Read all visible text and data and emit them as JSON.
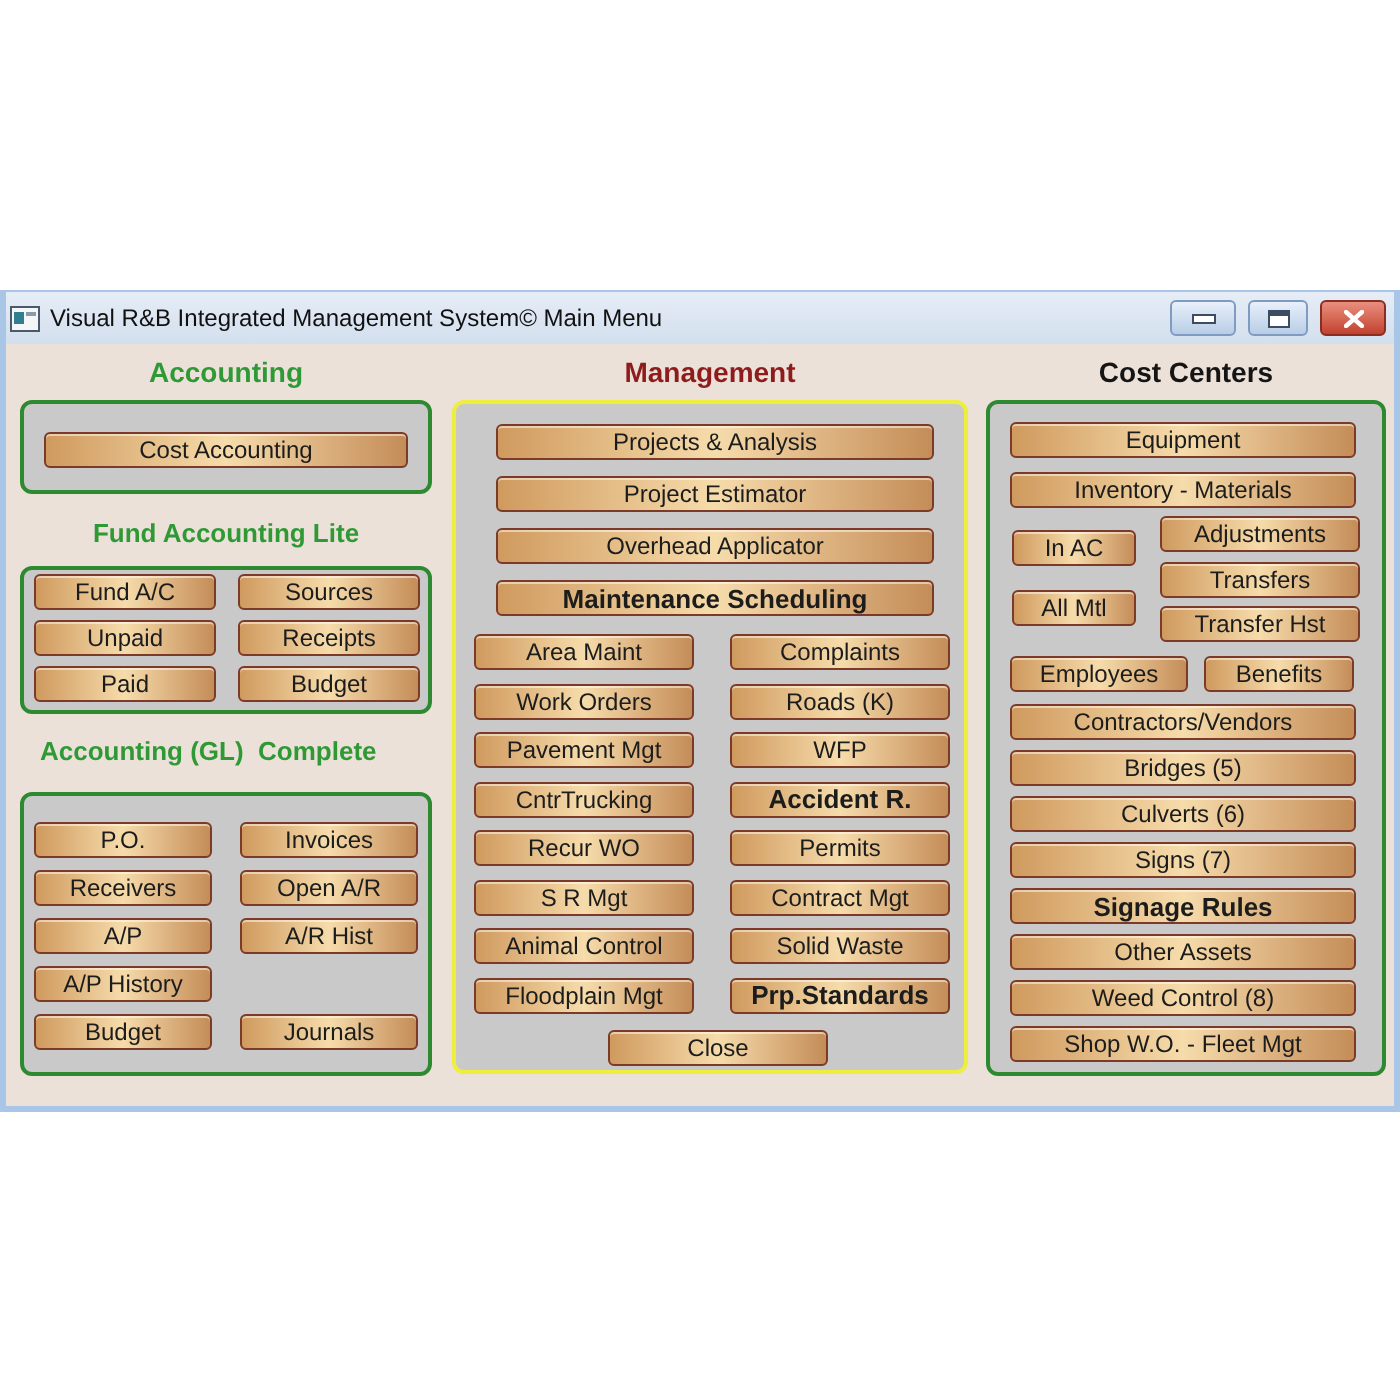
{
  "window": {
    "title": "Visual R&B Integrated Management System© Main Menu"
  },
  "accounting": {
    "heading": "Accounting",
    "button": {
      "label": "Cost Accounting",
      "bold": false
    }
  },
  "fund_accounting_lite": {
    "heading": "Fund Accounting Lite",
    "rows": [
      [
        {
          "label": "Fund A/C",
          "bold": false
        },
        {
          "label": "Sources",
          "bold": false
        }
      ],
      [
        {
          "label": "Unpaid",
          "bold": false
        },
        {
          "label": "Receipts",
          "bold": false
        }
      ],
      [
        {
          "label": "Paid",
          "bold": false
        },
        {
          "label": "Budget",
          "bold": false
        }
      ]
    ]
  },
  "accounting_gl": {
    "heading": "Accounting (GL)  Complete",
    "rows": [
      [
        {
          "label": "P.O.",
          "bold": false
        },
        {
          "label": "Invoices",
          "bold": false
        }
      ],
      [
        {
          "label": "Receivers",
          "bold": false
        },
        {
          "label": "Open A/R",
          "bold": false
        }
      ],
      [
        {
          "label": "A/P",
          "bold": false
        },
        {
          "label": "A/R Hist",
          "bold": false
        }
      ],
      [
        {
          "label": "A/P History",
          "bold": false
        }
      ],
      [
        {
          "label": "Budget",
          "bold": false
        },
        {
          "label": "Journals",
          "bold": false
        }
      ]
    ]
  },
  "management": {
    "heading": "Management",
    "wide_buttons": [
      {
        "label": "Projects & Analysis",
        "bold": false
      },
      {
        "label": "Project Estimator",
        "bold": false
      },
      {
        "label": "Overhead Applicator",
        "bold": false
      },
      {
        "label": "Maintenance Scheduling",
        "bold": true
      }
    ],
    "rows": [
      [
        {
          "label": "Area Maint",
          "bold": false
        },
        {
          "label": "Complaints",
          "bold": false
        }
      ],
      [
        {
          "label": "Work Orders",
          "bold": false
        },
        {
          "label": "Roads (K)",
          "bold": false
        }
      ],
      [
        {
          "label": "Pavement Mgt",
          "bold": false
        },
        {
          "label": "WFP",
          "bold": false
        }
      ],
      [
        {
          "label": "CntrTrucking",
          "bold": false
        },
        {
          "label": "Accident R.",
          "bold": true
        }
      ],
      [
        {
          "label": "Recur WO",
          "bold": false
        },
        {
          "label": "Permits",
          "bold": false
        }
      ],
      [
        {
          "label": "S R Mgt",
          "bold": false
        },
        {
          "label": "Contract Mgt",
          "bold": false
        }
      ],
      [
        {
          "label": "Animal Control",
          "bold": false
        },
        {
          "label": "Solid Waste",
          "bold": false
        }
      ],
      [
        {
          "label": "Floodplain Mgt",
          "bold": false
        },
        {
          "label": "Prp.Standards",
          "bold": true
        }
      ]
    ],
    "close_button": {
      "label": "Close",
      "bold": false
    }
  },
  "cost_centers": {
    "heading": "Cost Centers",
    "top_buttons": [
      {
        "label": "Equipment",
        "bold": false
      },
      {
        "label": "Inventory - Materials",
        "bold": false
      }
    ],
    "inventory_left": [
      {
        "label": "In AC",
        "bold": false
      },
      {
        "label": "All Mtl",
        "bold": false
      }
    ],
    "inventory_right": [
      {
        "label": "Adjustments",
        "bold": false
      },
      {
        "label": "Transfers",
        "bold": false
      },
      {
        "label": "Transfer Hst",
        "bold": false
      }
    ],
    "pair": [
      {
        "label": "Employees",
        "bold": false
      },
      {
        "label": "Benefits",
        "bold": false
      }
    ],
    "bottom_buttons": [
      {
        "label": "Contractors/Vendors",
        "bold": false
      },
      {
        "label": "Bridges (5)",
        "bold": false
      },
      {
        "label": "Culverts (6)",
        "bold": false
      },
      {
        "label": "Signs (7)",
        "bold": false
      },
      {
        "label": "Signage Rules",
        "bold": true
      },
      {
        "label": "Other Assets",
        "bold": false
      },
      {
        "label": "Weed Control (8)",
        "bold": false
      },
      {
        "label": "Shop W.O. - Fleet Mgt",
        "bold": false
      }
    ]
  }
}
